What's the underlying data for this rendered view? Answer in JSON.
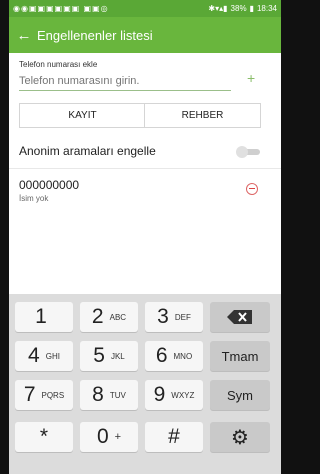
{
  "statusbar": {
    "battery": "38%",
    "time": "18:34"
  },
  "appbar": {
    "title": "Engellenenler listesi"
  },
  "form": {
    "add_label": "Telefon numarası ekle",
    "phone_placeholder": "Telefon numarasını girin.",
    "save_label": "KAYIT",
    "contacts_label": "REHBER"
  },
  "anon": {
    "label": "Anonim aramaları engelle",
    "enabled": false
  },
  "blocked": [
    {
      "number": "000000000",
      "name": "İsim yok"
    }
  ],
  "keypad": {
    "rows": [
      [
        {
          "d": "1",
          "l": ""
        },
        {
          "d": "2",
          "l": "ABC"
        },
        {
          "d": "3",
          "l": "DEF"
        }
      ],
      [
        {
          "d": "4",
          "l": "GHI"
        },
        {
          "d": "5",
          "l": "JKL"
        },
        {
          "d": "6",
          "l": "MNO"
        }
      ],
      [
        {
          "d": "7",
          "l": "PQRS"
        },
        {
          "d": "8",
          "l": "TUV"
        },
        {
          "d": "9",
          "l": "WXYZ"
        }
      ],
      [
        {
          "d": "*",
          "l": ""
        },
        {
          "d": "0",
          "l": "+"
        },
        {
          "d": "#",
          "l": ""
        }
      ]
    ],
    "side": [
      "backspace-icon",
      "Tmam",
      "Sym",
      "gear-icon"
    ]
  },
  "colors": {
    "statusbar": "#5aa836",
    "appbar": "#69b63d",
    "accent": "#8abd6a",
    "remove": "#d44"
  }
}
